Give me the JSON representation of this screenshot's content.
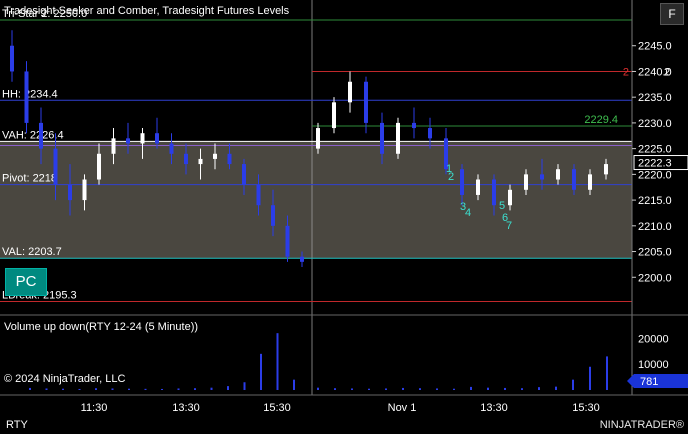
{
  "chart_data": {
    "type": "candlestick",
    "title": "Tradesight Seeker and Comber, Tradesight Futures Levels",
    "instrument": "RTY",
    "y_ticks": [
      2200.0,
      2205.0,
      2210.0,
      2215.0,
      2220.0,
      2225.0,
      2230.0,
      2235.0,
      2240.0,
      2245.0
    ],
    "ylim": [
      2195.0,
      2250.0
    ],
    "x_ticks": [
      "11:30",
      "13:30",
      "15:30",
      "Nov 1",
      "13:30",
      "15:30"
    ],
    "last_price": "2222.3",
    "price_row2": "2",
    "levels": [
      {
        "label": "Tri-Star 2: 2250.0",
        "value": 2250.0,
        "color": "#2e8b3a"
      },
      {
        "label": "",
        "value": 2240.0,
        "color": "#c0282b"
      },
      {
        "label": "HH: 2234.4",
        "value": 2234.4,
        "color": "#3040d0"
      },
      {
        "label": "",
        "value": 2229.4,
        "color": "#2e8b3a"
      },
      {
        "label": "VAH: 2226.4",
        "value": 2226.4,
        "color": "#ffffff"
      },
      {
        "label": "",
        "value": 2225.6,
        "color": "#8a5fc8"
      },
      {
        "label": "Pivot: 2218",
        "value": 2218.0,
        "color": "#3040d0"
      },
      {
        "label": "VAL: 2203.7",
        "value": 2203.7,
        "color": "#20c0c0"
      },
      {
        "label": "LBreak: 2195.3",
        "value": 2195.3,
        "color": "#c0282b"
      }
    ],
    "level_green_label": "2229.4",
    "level_red_marker": "2",
    "value_area": {
      "high": 2226.4,
      "low": 2203.7
    },
    "signal_labels": [
      "1",
      "2",
      "3",
      "4",
      "5",
      "6",
      "7"
    ],
    "volume_panel": {
      "title": "Volume up down(RTY 12-24 (5 Minute))",
      "y_ticks": [
        10000,
        20000
      ],
      "last_volume": "781"
    },
    "pc_label": "PC",
    "f_label": "F",
    "copyright": "© 2024 NinjaTrader, LLC",
    "brand": "NINJATRADER®",
    "candles_day1": [
      [
        2245,
        2248,
        2238,
        2240
      ],
      [
        2240,
        2242,
        2228,
        2230
      ],
      [
        2230,
        2233,
        2222,
        2225
      ],
      [
        2225,
        2228,
        2215,
        2218
      ],
      [
        2218,
        2222,
        2212,
        2215
      ],
      [
        2215,
        2220,
        2213,
        2219
      ],
      [
        2219,
        2226,
        2218,
        2224
      ],
      [
        2224,
        2229,
        2222,
        2227
      ],
      [
        2227,
        2230,
        2224,
        2226
      ],
      [
        2226,
        2229,
        2223,
        2228
      ],
      [
        2228,
        2231,
        2225,
        2226
      ],
      [
        2226,
        2228,
        2222,
        2224
      ],
      [
        2224,
        2226,
        2220,
        2222
      ],
      [
        2222,
        2225,
        2219,
        2223
      ],
      [
        2223,
        2226,
        2221,
        2224
      ],
      [
        2224,
        2226,
        2221,
        2222
      ],
      [
        2222,
        2223,
        2216,
        2218
      ],
      [
        2218,
        2220,
        2212,
        2214
      ],
      [
        2214,
        2217,
        2208,
        2210
      ],
      [
        2210,
        2212,
        2203,
        2204
      ],
      [
        2204,
        2205,
        2202,
        2203
      ]
    ],
    "candles_day2": [
      [
        2225,
        2230,
        2224,
        2229
      ],
      [
        2229,
        2235,
        2228,
        2234
      ],
      [
        2234,
        2240,
        2232,
        2238
      ],
      [
        2238,
        2239,
        2228,
        2230
      ],
      [
        2230,
        2232,
        2222,
        2224
      ],
      [
        2224,
        2231,
        2223,
        2230
      ],
      [
        2230,
        2233,
        2227,
        2229
      ],
      [
        2229,
        2231,
        2225,
        2227
      ],
      [
        2227,
        2229,
        2220,
        2221
      ],
      [
        2221,
        2222,
        2214,
        2216
      ],
      [
        2216,
        2220,
        2215,
        2219
      ],
      [
        2219,
        2220,
        2212,
        2214
      ],
      [
        2214,
        2218,
        2213,
        2217
      ],
      [
        2217,
        2221,
        2216,
        2220
      ],
      [
        2220,
        2223,
        2217,
        2219
      ],
      [
        2219,
        2222,
        2218,
        2221
      ],
      [
        2221,
        2222,
        2216,
        2217
      ],
      [
        2217,
        2221,
        2216,
        2220
      ],
      [
        2220,
        2223,
        2219,
        2222
      ]
    ],
    "volume_day1": [
      800,
      600,
      500,
      400,
      700,
      600,
      500,
      450,
      400,
      600,
      700,
      900,
      1500,
      3000,
      14000,
      22000,
      4000
    ],
    "volume_day2": [
      900,
      700,
      600,
      500,
      600,
      800,
      700,
      600,
      500,
      1200,
      900,
      800,
      700,
      1100,
      1300,
      4000,
      9000,
      13000
    ]
  }
}
